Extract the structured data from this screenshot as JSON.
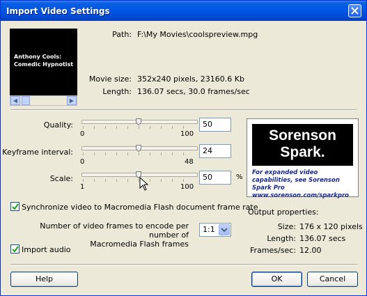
{
  "window": {
    "title": "Import Video Settings"
  },
  "preview": {
    "lines": "Anthony Cools:\nComedic Hypnotist"
  },
  "info": {
    "path_label": "Path:",
    "path_value": "F:\\My Movies\\coolspreview.mpg",
    "size_label": "Movie size:",
    "size_value": "352x240 pixels, 23160.6 Kb",
    "length_label": "Length:",
    "length_value": "136.07 secs, 30.0 frames/sec"
  },
  "sliders": [
    {
      "label": "Quality:",
      "min": "0",
      "max": "100",
      "value": "50",
      "level": 0.5
    },
    {
      "label": "Keyframe interval:",
      "min": "0",
      "max": "48",
      "value": "24",
      "level": 0.5
    },
    {
      "label": "Scale:",
      "min": "1",
      "max": "100",
      "value": "50",
      "level": 0.5,
      "unit": "%"
    }
  ],
  "sync": {
    "label": "Synchronize video to Macromedia Flash document frame rate",
    "checked": true
  },
  "frames": {
    "label": "Number of video frames to encode per number of\nMacromedia Flash frames",
    "value": "1:1"
  },
  "audio": {
    "label": "Import audio",
    "checked": true
  },
  "promo": {
    "brand_line1": "Sorenson",
    "brand_line2": "Spark.",
    "tagline": "For expanded video capabilities, see Sorenson Spark Pro www.sorenson.com/sparkpro"
  },
  "output": {
    "heading": "Output properties:",
    "size_label": "Size:",
    "size_value": "176 x 120 pixels",
    "length_label": "Length:",
    "length_value": "136.07 secs",
    "fps_label": "Frames/sec:",
    "fps_value": "12.00"
  },
  "buttons": {
    "help": "Help",
    "ok": "OK",
    "cancel": "Cancel"
  },
  "colors": {
    "titlebar": "#0055e5",
    "dialog_bg": "#ece9d8",
    "promo_text": "#1a2a8c"
  }
}
